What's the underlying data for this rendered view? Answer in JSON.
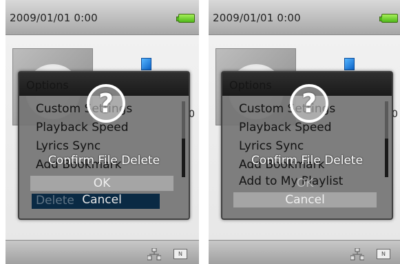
{
  "screens": [
    {
      "status": {
        "datetime": "2009/01/01   0:00"
      },
      "side_text": "0",
      "options": {
        "title": "Options",
        "items": [
          "Custom Settings",
          "Playback Speed",
          "Lyrics Sync",
          "Add Bookmark"
        ],
        "highlighted_item": "Delete"
      },
      "dialog": {
        "icon": "question-icon",
        "glyph": "?",
        "message": "Confirm File Delete",
        "ok_label": "OK",
        "cancel_label": "Cancel",
        "selected": "ok"
      },
      "bottom": {
        "n_label": "N"
      }
    },
    {
      "status": {
        "datetime": "2009/01/01   0:00"
      },
      "side_text": "0",
      "options": {
        "title": "Options",
        "items": [
          "Custom Settings",
          "Playback Speed",
          "Lyrics Sync",
          "Add Bookmark",
          "Add to My Playlist"
        ]
      },
      "dialog": {
        "icon": "question-icon",
        "glyph": "?",
        "message": "Confirm File Delete",
        "ok_label": "OK",
        "cancel_label": "Cancel",
        "selected": "cancel"
      },
      "bottom": {
        "n_label": "N"
      }
    }
  ],
  "colors": {
    "battery": "#4fb81a",
    "selection": "#a5a5a5",
    "list_highlight": "#0a2a44"
  }
}
